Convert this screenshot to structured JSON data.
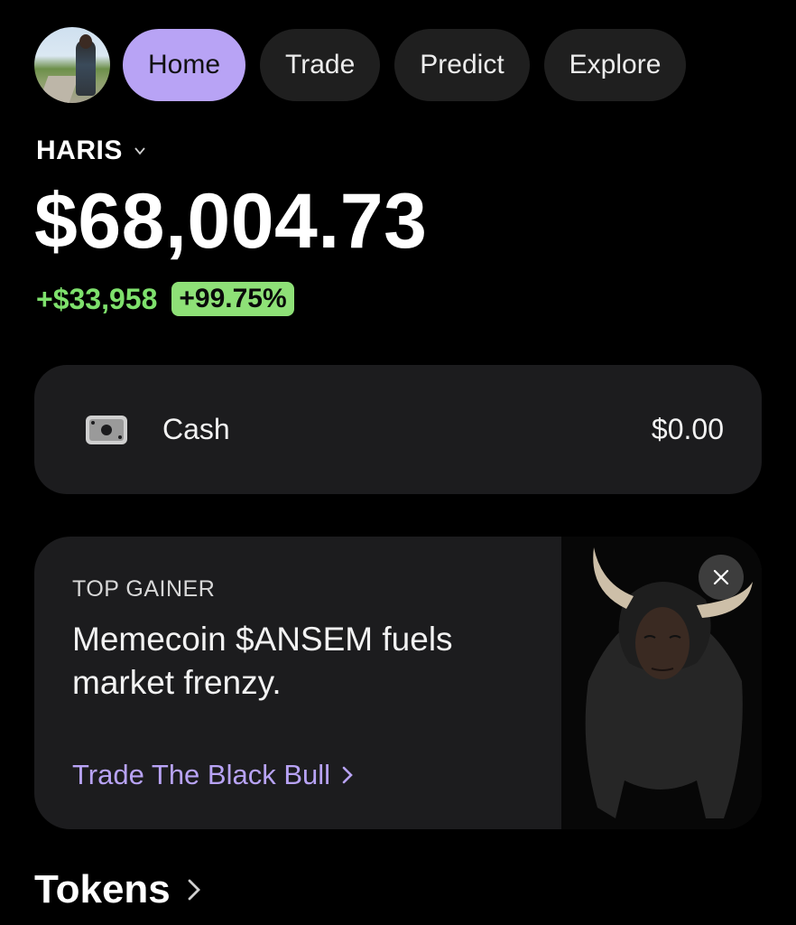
{
  "nav": {
    "avatar_icon": "profile-avatar",
    "tabs": [
      {
        "label": "Home",
        "active": true
      },
      {
        "label": "Trade",
        "active": false
      },
      {
        "label": "Predict",
        "active": false
      },
      {
        "label": "Explore",
        "active": false
      }
    ]
  },
  "account": {
    "name": "HARIS",
    "chevron_icon": "chevron-down-icon"
  },
  "portfolio": {
    "balance": "$68,004.73",
    "change_abs": "+$33,958",
    "change_pct": "+99.75%"
  },
  "cash": {
    "icon": "banknote-icon",
    "label": "Cash",
    "amount": "$0.00"
  },
  "promo": {
    "kicker": "TOP GAINER",
    "headline": "Memecoin $ANSEM fuels market frenzy.",
    "cta": "Trade The Black Bull",
    "close_icon": "close-icon",
    "image": "black-bull-illustration"
  },
  "tokens": {
    "title": "Tokens"
  },
  "colors": {
    "accent": "#b8a3f5",
    "positive": "#7ee06c",
    "positive_badge": "#8ee077",
    "card": "#1c1c1e",
    "background": "#000000"
  }
}
